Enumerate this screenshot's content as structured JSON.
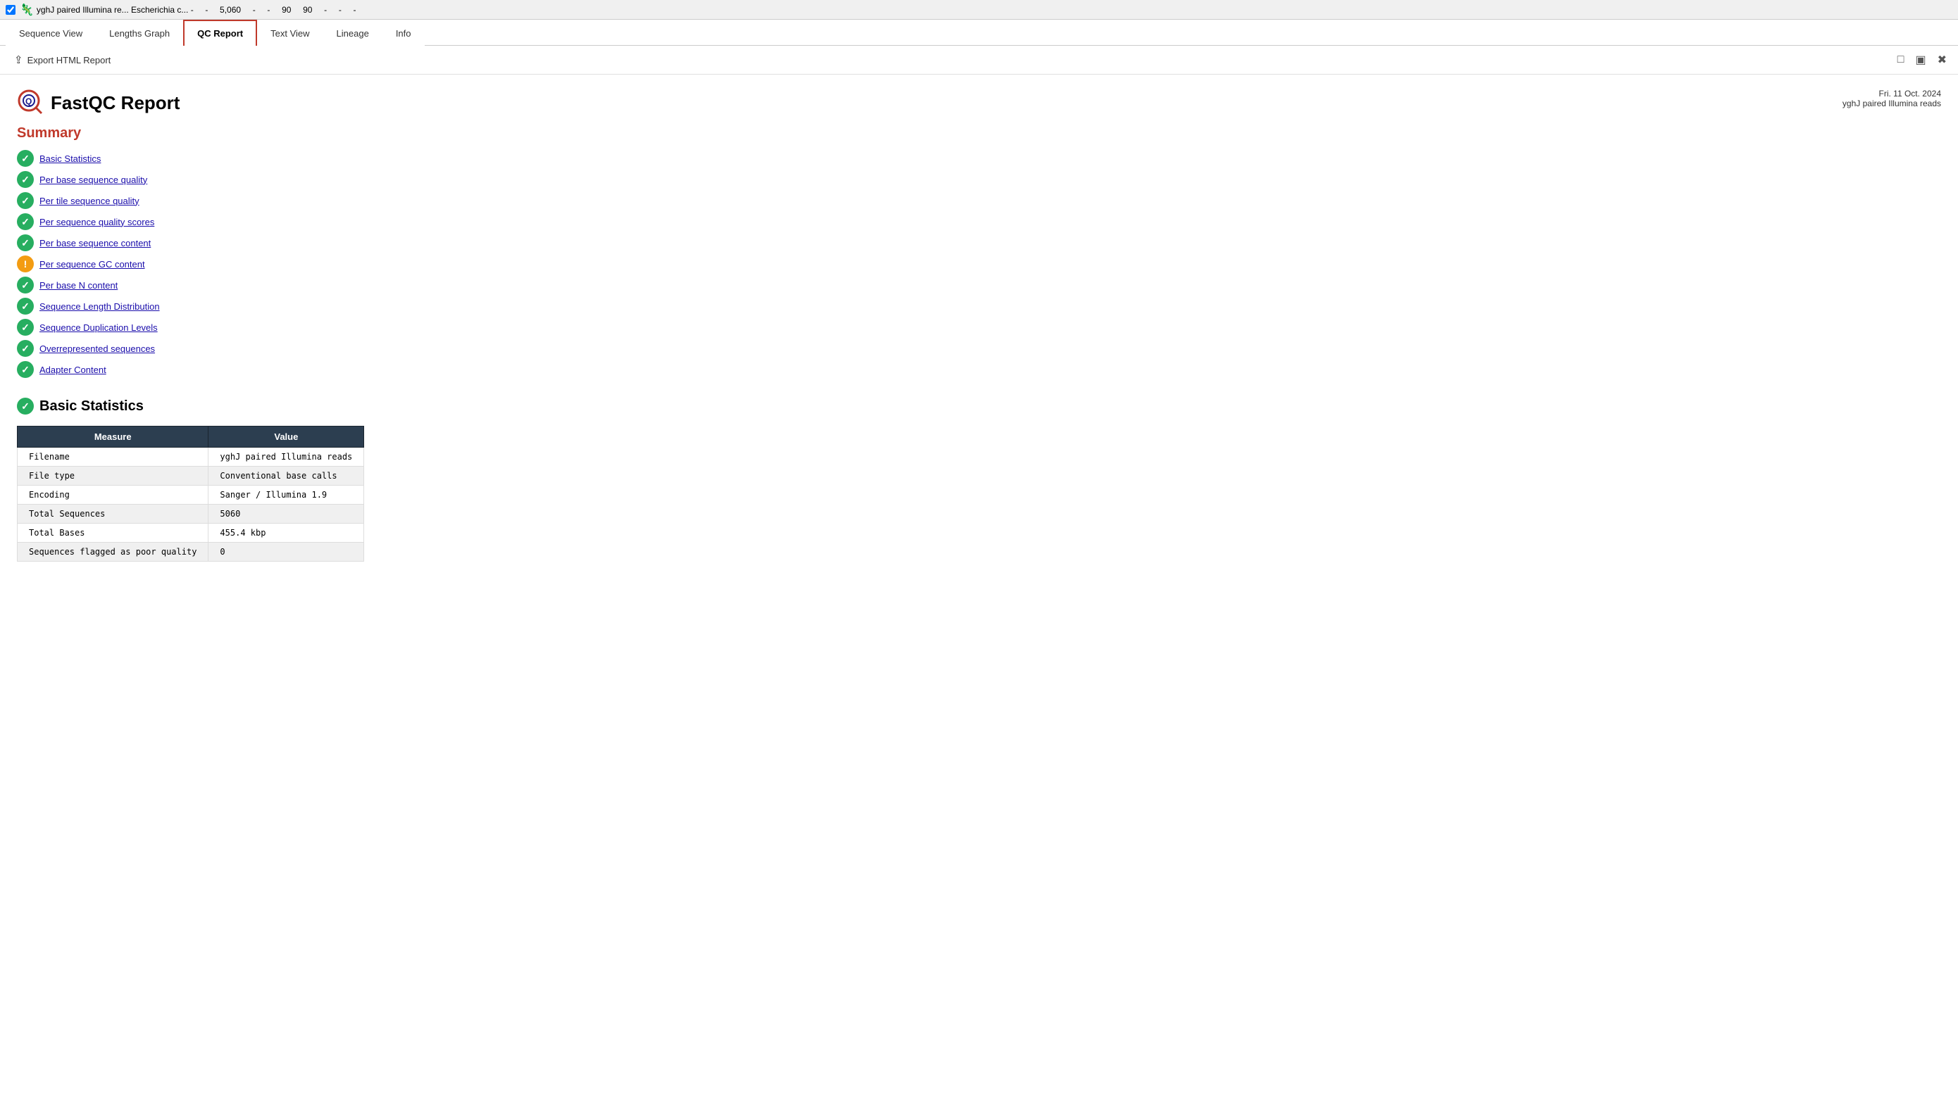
{
  "topbar": {
    "checkbox_checked": true,
    "favicon": "🦎",
    "tab_title": "yghJ paired Illumina re...",
    "tab_subtitle": "Escherichia c... -",
    "col1": "-",
    "col2": "5,060",
    "col3": "-",
    "col4": "-",
    "col5": "90",
    "col6": "90",
    "col7": "-",
    "col8": "-",
    "col9": "-"
  },
  "nav": {
    "tabs": [
      {
        "id": "sequence-view",
        "label": "Sequence View",
        "active": false
      },
      {
        "id": "lengths-graph",
        "label": "Lengths Graph",
        "active": false
      },
      {
        "id": "qc-report",
        "label": "QC Report",
        "active": true
      },
      {
        "id": "text-view",
        "label": "Text View",
        "active": false
      },
      {
        "id": "lineage",
        "label": "Lineage",
        "active": false
      },
      {
        "id": "info",
        "label": "Info",
        "active": false
      }
    ]
  },
  "toolbar": {
    "export_label": "Export HTML Report",
    "icons": [
      "⊡",
      "⊟",
      "⊠"
    ]
  },
  "report": {
    "title": "FastQC Report",
    "date": "Fri. 11 Oct. 2024",
    "sample_name": "yghJ paired Illumina reads",
    "summary_title": "Summary",
    "summary_items": [
      {
        "id": "basic-statistics",
        "label": "Basic Statistics",
        "status": "pass"
      },
      {
        "id": "per-base-sequence-quality",
        "label": "Per base sequence quality",
        "status": "pass"
      },
      {
        "id": "per-tile-sequence-quality",
        "label": "Per tile sequence quality",
        "status": "pass"
      },
      {
        "id": "per-sequence-quality-scores",
        "label": "Per sequence quality scores",
        "status": "pass"
      },
      {
        "id": "per-base-sequence-content",
        "label": "Per base sequence content",
        "status": "pass"
      },
      {
        "id": "per-sequence-gc-content",
        "label": "Per sequence GC content",
        "status": "warn"
      },
      {
        "id": "per-base-n-content",
        "label": "Per base N content",
        "status": "pass"
      },
      {
        "id": "sequence-length-distribution",
        "label": "Sequence Length Distribution",
        "status": "pass"
      },
      {
        "id": "sequence-duplication-levels",
        "label": "Sequence Duplication Levels",
        "status": "pass"
      },
      {
        "id": "overrepresented-sequences",
        "label": "Overrepresented sequences",
        "status": "pass"
      },
      {
        "id": "adapter-content",
        "label": "Adapter Content",
        "status": "pass"
      }
    ],
    "basic_statistics": {
      "section_title": "Basic Statistics",
      "table_headers": [
        "Measure",
        "Value"
      ],
      "rows": [
        {
          "measure": "Filename",
          "value": "yghJ paired Illumina reads"
        },
        {
          "measure": "File type",
          "value": "Conventional base calls"
        },
        {
          "measure": "Encoding",
          "value": "Sanger / Illumina 1.9"
        },
        {
          "measure": "Total Sequences",
          "value": "5060"
        },
        {
          "measure": "Total Bases",
          "value": "455.4 kbp"
        },
        {
          "measure": "Sequences flagged as poor quality",
          "value": "0"
        }
      ]
    }
  }
}
